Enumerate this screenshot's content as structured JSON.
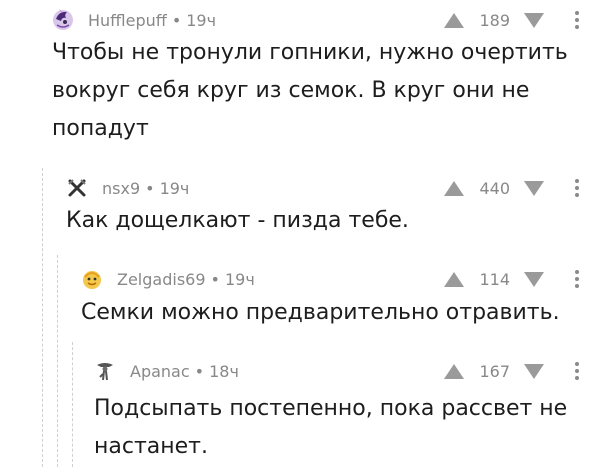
{
  "comments": [
    {
      "author": "Hufflepuff",
      "time": "19ч",
      "score": "189",
      "text": "Чтобы не тронули гопники, нужно очертить вокруг себя круг из семок. В круг они не попадут",
      "avatar_icon": "pony-avatar-icon"
    },
    {
      "author": "nsx9",
      "time": "19ч",
      "score": "440",
      "text": "Как дощелкают - пизда тебе.",
      "avatar_icon": "crossed-swords-avatar-icon"
    },
    {
      "author": "Zelgadis69",
      "time": "19ч",
      "score": "114",
      "text": "Семки можно предварительно отравить.",
      "avatar_icon": "yellow-face-avatar-icon"
    },
    {
      "author": "Apanac",
      "time": "18ч",
      "score": "167",
      "text": "Подсыпать постепенно, пока рассвет не настанет.",
      "avatar_icon": "figure-avatar-icon"
    }
  ],
  "separator": "•",
  "colors": {
    "meta_gray": "#888888",
    "vote_gray": "#9a9a9a",
    "thread_line": "#cfcfcf"
  }
}
